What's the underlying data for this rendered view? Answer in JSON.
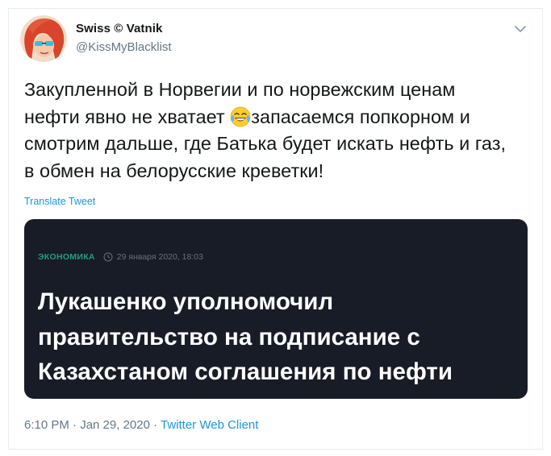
{
  "author": {
    "display_name": "Swiss © Vatnik",
    "handle": "@KissMyBlacklist",
    "avatar_icon": "avatar-icon"
  },
  "menu": {
    "caret_icon": "chevron-down-icon"
  },
  "tweet": {
    "lines": [
      "Закупленной в Норвегии и по норвежским ценам",
      "нефти явно не хватает ",
      "запасаемся попкорном и",
      "смотрим дальше, где Батька будет искать нефть и газ,",
      "в обмен на белорусские креветки!"
    ],
    "emoji_icon": "face-with-tears-of-joy-icon"
  },
  "translate_label": "Translate Tweet",
  "card": {
    "category": "ЭКОНОМИКА",
    "clock_icon": "clock-icon",
    "date": "29 января 2020, 18:03",
    "headline_lines": [
      "Лукашенко уполномочил",
      "правительство на подписание с",
      "Казахстаном соглашения по нефти"
    ]
  },
  "footer": {
    "timestamp": "6:10 PM · Jan 29, 2020 · ",
    "client": "Twitter Web Client"
  },
  "colors": {
    "link_blue": "#1b95e0",
    "card_background": "#181c27",
    "category_green": "#1fa07f",
    "muted_gray": "#657786"
  }
}
